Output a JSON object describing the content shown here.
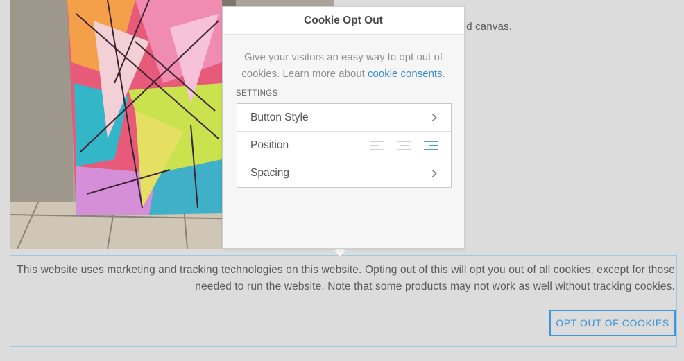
{
  "page": {
    "product_text": "ery wrapped canvas."
  },
  "panel": {
    "title": "Cookie Opt Out",
    "description": "Give your visitors an easy way to opt out of cookies. Learn more about ",
    "description_link": "cookie consents",
    "description_end": ".",
    "settings_label": "SETTINGS",
    "rows": [
      {
        "label": "Button Style",
        "control": "chevron-right-icon"
      },
      {
        "label": "Position",
        "control": "alignment-buttons",
        "options": [
          "align-left-icon",
          "align-center-icon",
          "align-right-icon"
        ],
        "selected": "align-right-icon"
      },
      {
        "label": "Spacing",
        "control": "chevron-right-icon"
      }
    ]
  },
  "banner": {
    "message": "This website uses marketing and tracking technologies on this website. Opting out of this will opt you out of all cookies, except for those needed to run the website. Note that some products may not work as well without tracking cookies.",
    "button_label": "OPT OUT OF COOKIES"
  },
  "colors": {
    "accent": "#3f95d6",
    "link": "#3a8fd2",
    "page_background": "#dcdcdc",
    "panel_background": "#f6f6f6"
  }
}
